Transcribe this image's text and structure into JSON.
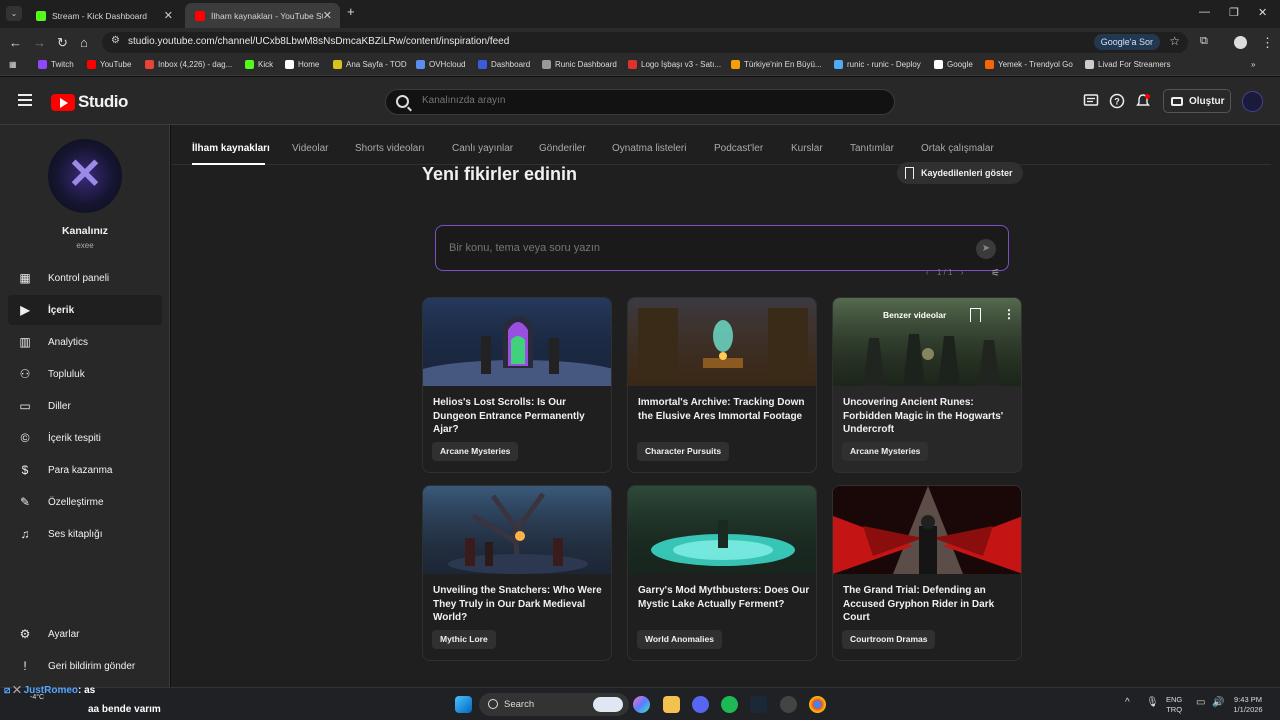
{
  "browser": {
    "tabs": [
      {
        "label": "Stream - Kick Dashboard",
        "favicon_color": "#53fc18"
      },
      {
        "label": "İlham kaynakları - YouTube Studio",
        "favicon_color": "#ff0000"
      }
    ],
    "url": "studio.youtube.com/channel/UCxb8LbwM8sNsDmcaKBZiLRw/content/inspiration/feed",
    "ask_google": "Google'a Sor",
    "bookmarks": [
      {
        "label": "Twitch",
        "color": "#9146ff"
      },
      {
        "label": "YouTube",
        "color": "#ff0000"
      },
      {
        "label": "Inbox (4,226) - dag...",
        "color": "#ea4335"
      },
      {
        "label": "Kick",
        "color": "#53fc18"
      },
      {
        "label": "Home",
        "color": "#ffffff"
      },
      {
        "label": "Ana Sayfa - TOD",
        "color": "#d9c21b"
      },
      {
        "label": "OVHcloud",
        "color": "#5b8def"
      },
      {
        "label": "Dashboard",
        "color": "#3b5bdb"
      },
      {
        "label": "Runic Dashboard",
        "color": "#999999"
      },
      {
        "label": "Logo İşbaşı v3 - Satı...",
        "color": "#e03131"
      },
      {
        "label": "Türkiye'nin En Büyü...",
        "color": "#f59f00"
      },
      {
        "label": "runic - runic - Deploy",
        "color": "#4dabf7"
      },
      {
        "label": "Google",
        "color": "#ffffff"
      },
      {
        "label": "Yemek - Trendyol Go",
        "color": "#f76707"
      },
      {
        "label": "Livad For Streamers",
        "color": "#cccccc"
      }
    ]
  },
  "studio": {
    "logo_text": "Studio",
    "search_placeholder": "Kanalınızda arayın",
    "create_label": "Oluştur"
  },
  "sidebar": {
    "channel_title": "Kanalınız",
    "channel_handle": "exee",
    "items": [
      {
        "label": "Kontrol paneli",
        "icon": "dashboard-icon"
      },
      {
        "label": "İçerik",
        "icon": "content-icon",
        "active": true
      },
      {
        "label": "Analytics",
        "icon": "analytics-icon"
      },
      {
        "label": "Topluluk",
        "icon": "community-icon"
      },
      {
        "label": "Diller",
        "icon": "subtitles-icon"
      },
      {
        "label": "İçerik tespiti",
        "icon": "copyright-icon"
      },
      {
        "label": "Para kazanma",
        "icon": "dollar-icon"
      },
      {
        "label": "Özelleştirme",
        "icon": "wand-icon"
      },
      {
        "label": "Ses kitaplığı",
        "icon": "audio-library-icon"
      }
    ],
    "bottom_items": [
      {
        "label": "Ayarlar",
        "icon": "gear-icon"
      },
      {
        "label": "Geri bildirim gönder",
        "icon": "feedback-icon"
      }
    ]
  },
  "content_tabs": [
    "İlham kaynakları",
    "Videolar",
    "Shorts videoları",
    "Canlı yayınlar",
    "Gönderiler",
    "Oynatma listeleri",
    "Podcast'ler",
    "Kurslar",
    "Tanıtımlar",
    "Ortak çalışmalar"
  ],
  "feed": {
    "title": "Yeni fikirler edinin",
    "saved_button": "Kaydedilenleri göster",
    "prompt_placeholder": "Bir konu, tema veya soru yazın",
    "pager": "1 / 1",
    "hover_label": "Benzer videolar",
    "cards": [
      {
        "title": "Helios's Lost Scrolls: Is Our Dungeon Entrance Permanently Ajar?",
        "chip": "Arcane Mysteries"
      },
      {
        "title": "Immortal's Archive: Tracking Down the Elusive Ares Immortal Footage",
        "chip": "Character Pursuits"
      },
      {
        "title": "Uncovering Ancient Runes: Forbidden Magic in the Hogwarts' Undercroft",
        "chip": "Arcane Mysteries"
      },
      {
        "title": "Unveiling the Snatchers: Who Were They Truly in Our Dark Medieval World?",
        "chip": "Mythic Lore"
      },
      {
        "title": "Garry's Mod Mythbusters: Does Our Mystic Lake Actually Ferment?",
        "chip": "World Anomalies"
      },
      {
        "title": "The Grand Trial: Defending an Accused Gryphon Rider in Dark Court",
        "chip": "Courtroom Dramas"
      }
    ]
  },
  "overlay_chat": {
    "user": "JustRomeo",
    "msg1": ": as",
    "msg2": "aa bende varım",
    "temp": "-4°C"
  },
  "taskbar": {
    "search_label": "Search",
    "lang": "ENG",
    "lang2": "TRQ",
    "time": "9:43 PM",
    "date": "1/1/2026"
  }
}
